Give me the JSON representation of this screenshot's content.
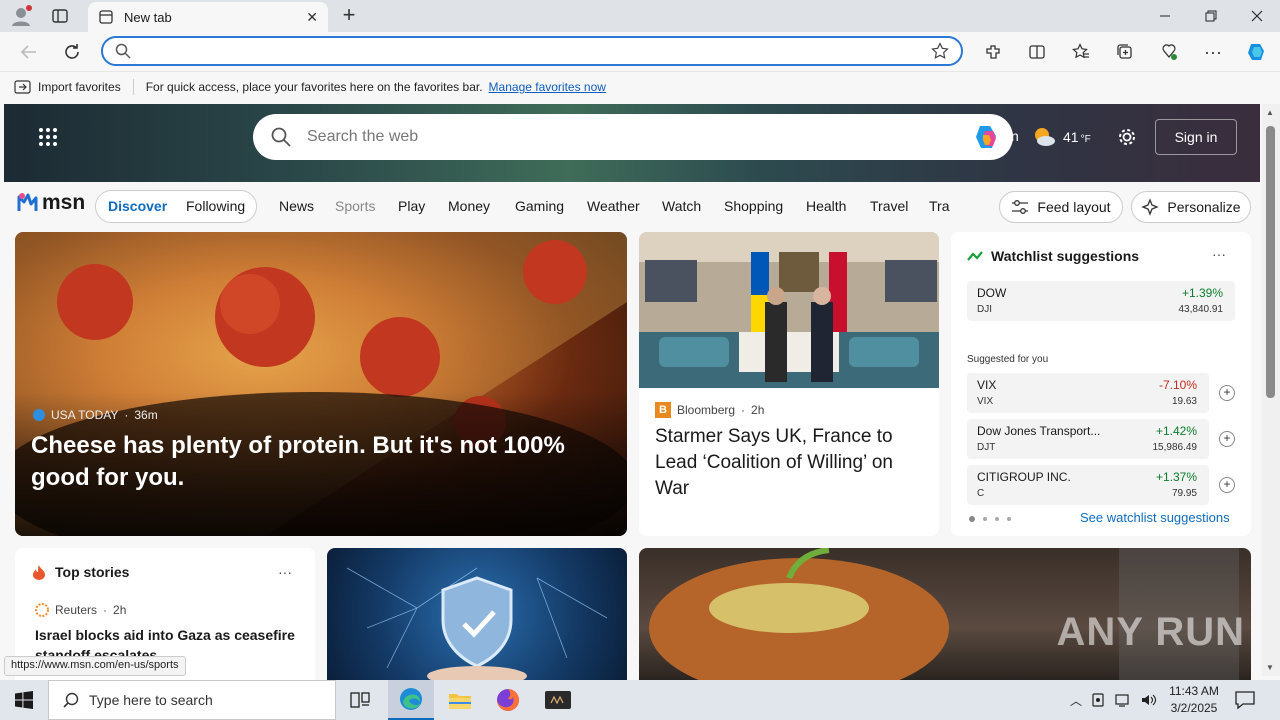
{
  "browser": {
    "tab_title": "New tab",
    "new_tab_symbol": "+",
    "address_value": "",
    "favorites_bar": {
      "import_label": "Import favorites",
      "message": "For quick access, place your favorites here on the favorites bar.",
      "manage_link": "Manage favorites now"
    },
    "status_url": "https://www.msn.com/en-us/sports"
  },
  "msn": {
    "search_placeholder": "Search the web",
    "weather_partial": "n",
    "temperature": "41",
    "temp_unit": "°F",
    "sign_in": "Sign in",
    "logo": "msn",
    "tabs": [
      "Discover",
      "Following"
    ],
    "nav": [
      "News",
      "Sports",
      "Play",
      "Money",
      "Gaming",
      "Weather",
      "Watch",
      "Shopping",
      "Health",
      "Travel",
      "Tra"
    ],
    "feed_layout": "Feed layout",
    "personalize": "Personalize"
  },
  "hero": {
    "source": "USA TODAY",
    "age": "36m",
    "headline": "Cheese has plenty of protein. But it's not 100% good for you."
  },
  "story2": {
    "source": "Bloomberg",
    "age": "2h",
    "headline": "Starmer Says UK, France to Lead ‘Coalition of Willing’ on War"
  },
  "watchlist": {
    "title": "Watchlist suggestions",
    "main": {
      "name": "DOW",
      "ticker": "DJI",
      "change": "+1.39%",
      "price": "43,840.91"
    },
    "suggested_label": "Suggested for you",
    "suggested": [
      {
        "name": "VIX",
        "ticker": "VIX",
        "change": "-7.10%",
        "price": "19.63"
      },
      {
        "name": "Dow Jones Transport...",
        "ticker": "DJT",
        "change": "+1.42%",
        "price": "15,986.49"
      },
      {
        "name": "CITIGROUP INC.",
        "ticker": "C",
        "change": "+1.37%",
        "price": "79.95"
      }
    ],
    "see_link": "See watchlist suggestions",
    "colors": {
      "up": "#0a7d2c",
      "down": "#c42b1c"
    }
  },
  "top_stories": {
    "title": "Top stories",
    "source": "Reuters",
    "age": "2h",
    "headline": "Israel blocks aid into Gaza as ceasefire standoff escalates"
  },
  "watermark": "ANY RUN",
  "taskbar": {
    "search_placeholder": "Type here to search",
    "time": "11:43 AM",
    "date": "3/2/2025"
  },
  "accent": "#0f6cbd"
}
